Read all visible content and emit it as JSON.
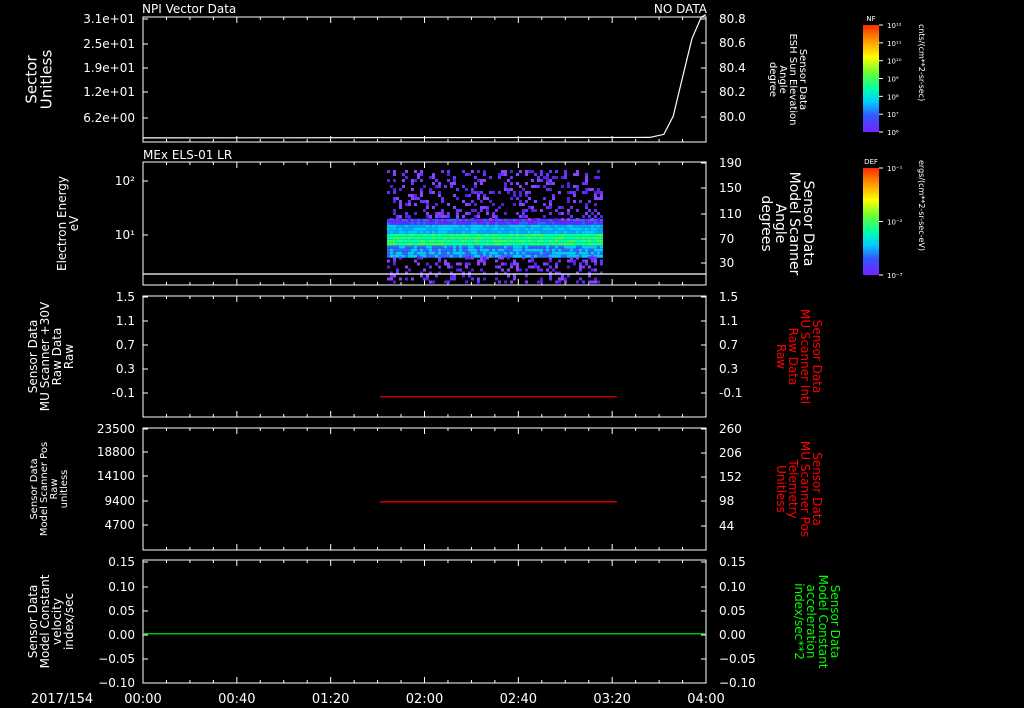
{
  "page": {
    "background": "#000000",
    "foreground": "#ffffff"
  },
  "header": {
    "left_title": "NPI Vector Data",
    "right_title": "NO DATA"
  },
  "x_axis": {
    "day_label": "2017/154",
    "ticks": [
      "00:00",
      "00:40",
      "01:20",
      "02:00",
      "02:40",
      "03:20",
      "04:00"
    ],
    "range_minutes": [
      0,
      240
    ]
  },
  "chart_data": [
    {
      "type": "line",
      "title": "NPI Vector Data",
      "left_axis": {
        "label_lines": [
          "Sector",
          "Unitless"
        ],
        "ticks": [
          "3.1e+01",
          "2.5e+01",
          "1.9e+01",
          "1.2e+01",
          "6.2e+00"
        ]
      },
      "right_axis": {
        "label_lines": [
          "Sensor Data",
          "ESH Sun Elevation",
          "Angle",
          "degree"
        ],
        "ticks": [
          "80.8",
          "80.6",
          "80.4",
          "80.2",
          "80.0"
        ],
        "ylim": [
          79.8,
          80.8
        ]
      },
      "series": [
        {
          "color": "#ffffff",
          "x": [
            0,
            60,
            120,
            180,
            216,
            222,
            226,
            230,
            234,
            238,
            240
          ],
          "y": [
            79.801,
            79.802,
            79.803,
            79.804,
            79.805,
            79.83,
            79.98,
            80.3,
            80.62,
            80.8,
            80.82
          ]
        }
      ],
      "colorbar": {
        "label": "NF",
        "units": "cnts/(cm**2-sr-sec)",
        "ticks": [
          "10¹²",
          "10¹¹",
          "10¹⁰",
          "10⁹",
          "10⁸",
          "10⁷",
          "10⁶"
        ]
      }
    },
    {
      "type": "heatmap",
      "title": "MEx ELS-01 LR",
      "left_axis": {
        "label_lines": [
          "Electron Energy",
          "eV"
        ],
        "ticks": [
          "10²",
          "10¹"
        ],
        "scale": "log"
      },
      "right_axis": {
        "label_lines": [
          "Sensor Data",
          "Model Scanner",
          "Angle",
          "degrees"
        ],
        "ticks": [
          "190",
          "150",
          "110",
          "70",
          "30"
        ],
        "ylim": [
          0,
          190
        ]
      },
      "spectrogram": {
        "x_range": [
          104,
          196
        ],
        "energy_core_eV": [
          4,
          20
        ],
        "energy_extent_eV": [
          2,
          150
        ]
      },
      "series": [
        {
          "color": "#ffffff",
          "x": [
            0,
            240
          ],
          "y": [
            0,
            0
          ]
        }
      ],
      "colorbar": {
        "label": "DEF",
        "units": "ergs/(cm**2-sr-sec-eV)",
        "ticks": [
          "10⁻¹",
          "10⁻²",
          "10⁻³"
        ]
      }
    },
    {
      "type": "line",
      "left_axis": {
        "label_lines": [
          "Sensor Data",
          "MU Scanner +30V",
          "Raw Data",
          "Raw"
        ],
        "ticks": [
          "1.5",
          "1.1",
          "0.7",
          "0.3",
          "-0.1"
        ],
        "ylim": [
          -0.3,
          1.5
        ]
      },
      "right_axis": {
        "label_lines": [
          "Sensor Data",
          "MU Scanner Intl",
          "Raw Data",
          "Raw"
        ],
        "ticks": [
          "1.5",
          "1.1",
          "0.7",
          "0.3",
          "-0.1"
        ],
        "ylim": [
          -0.3,
          1.5
        ],
        "color": "#ff0000"
      },
      "series": [
        {
          "color": "#ff0000",
          "x": [
            101,
            202
          ],
          "y": [
            0.0,
            0.0
          ]
        }
      ]
    },
    {
      "type": "line",
      "left_axis": {
        "label_lines": [
          "Sensor Data",
          "Model Scanner Pos",
          "Raw",
          "unitless"
        ],
        "ticks": [
          "23500",
          "18800",
          "14100",
          "9400",
          "4700"
        ],
        "ylim": [
          0,
          23500
        ]
      },
      "right_axis": {
        "label_lines": [
          "Sensor Data",
          "MU Scanner Pos",
          "Telemetry",
          "Unitless"
        ],
        "ticks": [
          "260",
          "206",
          "152",
          "98",
          "44"
        ],
        "ylim": [
          0,
          260
        ],
        "color": "#ff0000"
      },
      "series": [
        {
          "color": "#ff0000",
          "x": [
            101,
            202
          ],
          "y": [
            8650,
            8650
          ]
        }
      ]
    },
    {
      "type": "line",
      "left_axis": {
        "label_lines": [
          "Sensor Data",
          "Model Constant",
          "velocity",
          "index/sec"
        ],
        "ticks": [
          "0.15",
          "0.10",
          "0.05",
          "0.00",
          "−0.05",
          "−0.10"
        ],
        "ylim": [
          -0.1,
          0.15
        ]
      },
      "right_axis": {
        "label_lines": [
          "Sensor Data",
          "Model Constant",
          "acceleration",
          "index/sec**2"
        ],
        "ticks": [
          "0.15",
          "0.10",
          "0.05",
          "0.00",
          "−0.05",
          "−0.10"
        ],
        "ylim": [
          -0.1,
          0.15
        ],
        "color": "#00ff00"
      },
      "series": [
        {
          "color": "#00ff00",
          "x": [
            0,
            240
          ],
          "y": [
            0.0,
            0.0
          ]
        }
      ]
    }
  ]
}
